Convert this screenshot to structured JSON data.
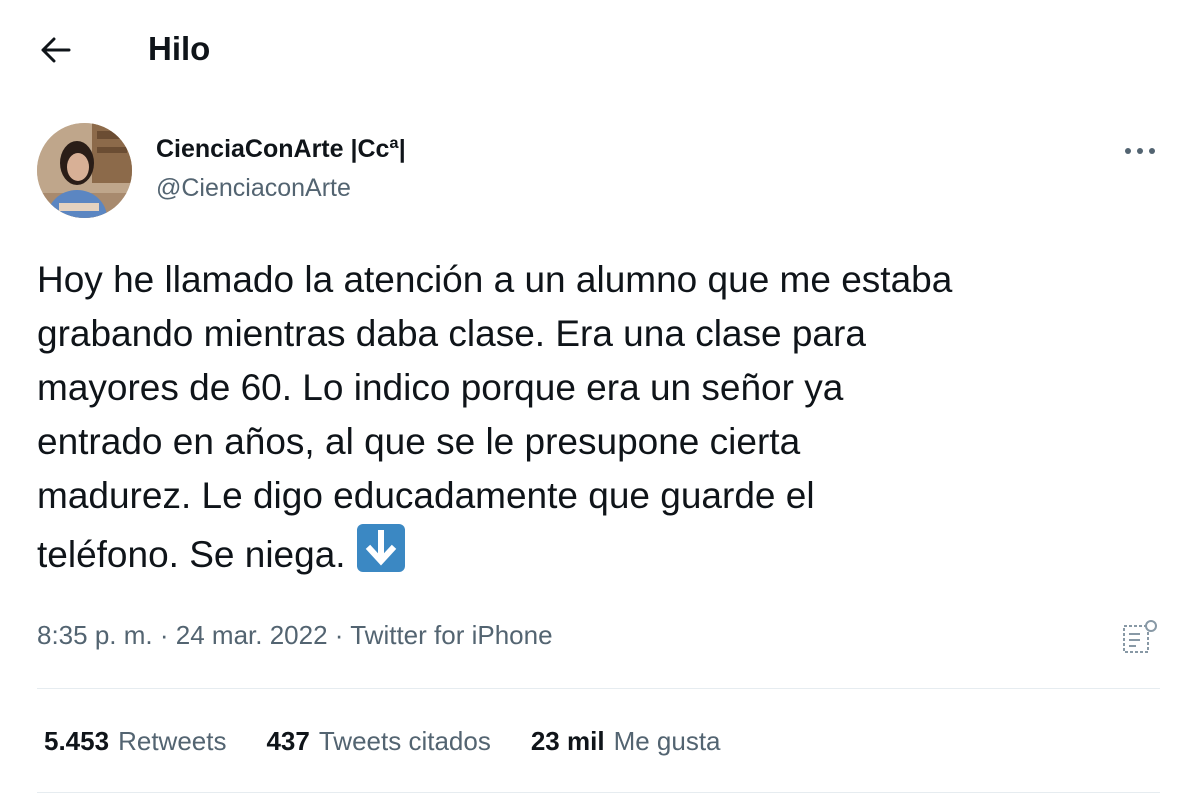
{
  "header": {
    "title": "Hilo",
    "back_icon": "arrow-left-icon"
  },
  "author": {
    "name": "CienciaConArte |Ccª|",
    "handle": "@CienciaconArte",
    "avatar_icon": "user-avatar-photo"
  },
  "tweet": {
    "text": "Hoy he llamado la atención a un alumno que me estaba\ngrabando mientras daba clase. Era una clase para\nmayores de 60. Lo indico porque era un señor ya\nentrado en años, al que se le presupone cierta\nmadurez. Le digo educadamente que guarde el\nteléfono. Se niega.",
    "emoji": "down-arrow-emoji"
  },
  "meta": {
    "time": "8:35 p. m.",
    "separator": "·",
    "date": "24 mar. 2022",
    "source": "Twitter for iPhone"
  },
  "stats": [
    {
      "number": "5.453",
      "label": "Retweets"
    },
    {
      "number": "437",
      "label": "Tweets citados"
    },
    {
      "number": "23 mil",
      "label": "Me gusta"
    }
  ],
  "colors": {
    "text": "#0f1419",
    "secondary": "#536471",
    "divider": "#e6ecf0",
    "emoji_blue": "#3b88c3"
  }
}
